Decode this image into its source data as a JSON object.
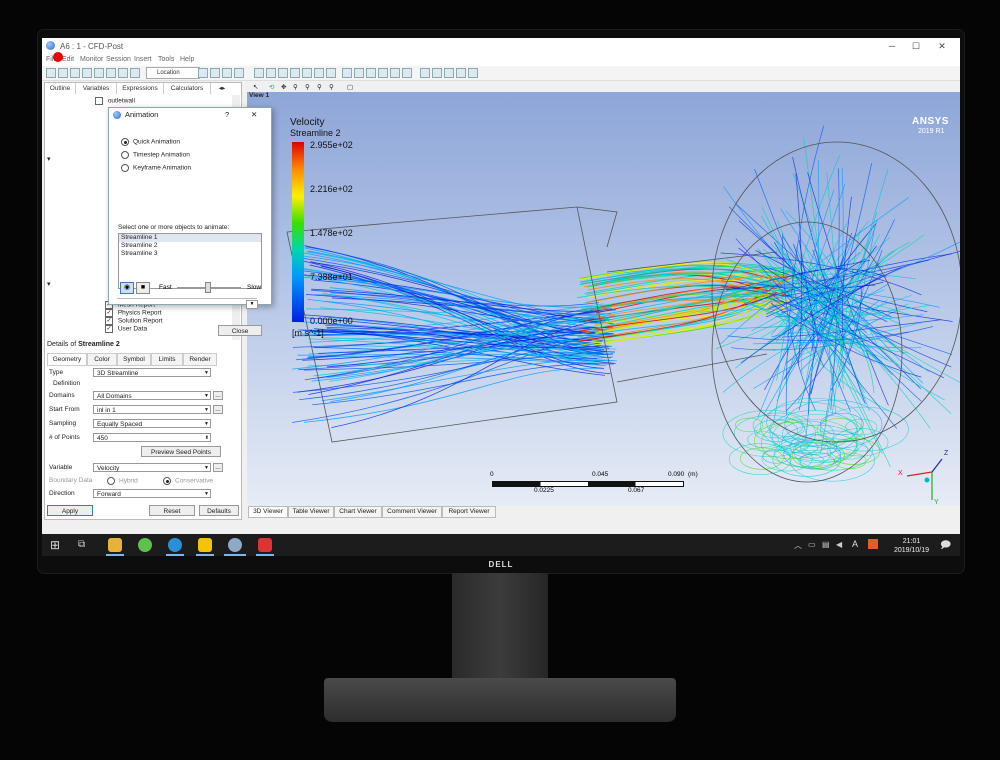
{
  "window": {
    "title": "A6 : 1 - CFD-Post"
  },
  "menu": [
    "File",
    "Edit",
    "Monitor",
    "Session",
    "Insert",
    "Tools",
    "Help"
  ],
  "toolbar": {
    "location_label": "Location"
  },
  "left_panel": {
    "tabs": [
      "Outline",
      "Variables",
      "Expressions",
      "Calculators"
    ],
    "tree_top": "outletwall",
    "tree_items": [
      "Mesh Report",
      "Physics Report",
      "Solution Report",
      "User Data"
    ]
  },
  "animation_dialog": {
    "title": "Animation",
    "help": "?",
    "close_x": "✕",
    "options": [
      "Quick Animation",
      "Timestep Animation",
      "Keyframe Animation"
    ],
    "selected_option": "Quick Animation",
    "select_prompt": "Select one or more objects to animate:",
    "objects": [
      "Streamline 1",
      "Streamline 2",
      "Streamline 3"
    ],
    "selected_object": "Streamline 1",
    "speed_fast": "Fast",
    "speed_slow": "Slow",
    "close_label": "Close"
  },
  "details": {
    "header_prefix": "Details of ",
    "header_name": "Streamline 2",
    "tabs": [
      "Geometry",
      "Color",
      "Symbol",
      "Limits",
      "Render"
    ],
    "type_label": "Type",
    "type_value": "3D Streamline",
    "definition_label": "Definition",
    "domains_label": "Domains",
    "domains_value": "All Domains",
    "start_from_label": "Start From",
    "start_from_value": "inl in 1",
    "sampling_label": "Sampling",
    "sampling_value": "Equally Spaced",
    "points_label": "# of Points",
    "points_value": "450",
    "preview_label": "Preview Seed Points",
    "variable_label": "Variable",
    "variable_value": "Velocity",
    "boundary_label": "Boundary Data",
    "hybrid_label": "Hybrid",
    "conservative_label": "Conservative",
    "direction_label": "Direction",
    "direction_value": "Forward",
    "apply_label": "Apply",
    "reset_label": "Reset",
    "defaults_label": "Defaults"
  },
  "viewer": {
    "view_label": "View 1",
    "legend_title": "Velocity",
    "legend_sub": "Streamline 2",
    "legend_values": [
      "2.955e+02",
      "2.216e+02",
      "1.478e+02",
      "7.388e+01",
      "0.000e+00"
    ],
    "legend_unit": "[m s^-1]",
    "brand": "ANSYS",
    "version": "2019 R1",
    "scale_top": [
      "0",
      "0.045",
      "0.090",
      "(m)"
    ],
    "scale_bottom": [
      "0.0225",
      "0.067"
    ],
    "axis_x": "X",
    "axis_y": "Y",
    "axis_z": "Z",
    "tabs": [
      "3D Viewer",
      "Table Viewer",
      "Chart Viewer",
      "Comment Viewer",
      "Report Viewer"
    ]
  },
  "taskbar": {
    "time": "21:01",
    "date": "2019/10/19",
    "ime": "A"
  },
  "monitor": {
    "brand": "DELL"
  },
  "colors": {
    "accent": "#3a78c8",
    "legend_max": "#e00000",
    "legend_min": "#0020e0"
  }
}
